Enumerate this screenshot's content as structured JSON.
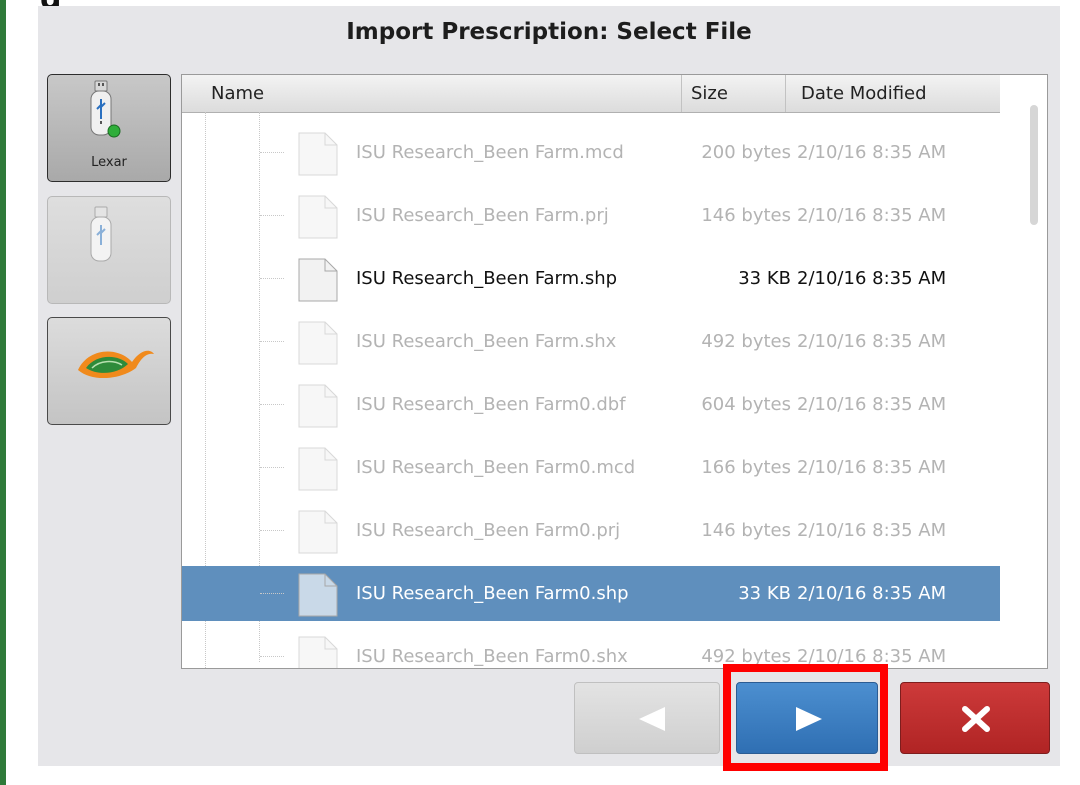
{
  "dialog": {
    "title": "Import Prescription: Select File"
  },
  "sources": [
    {
      "label": "Lexar",
      "icon": "usb-drive-icon"
    },
    {
      "label": "",
      "icon": "usb-drive-icon"
    },
    {
      "label": "",
      "icon": "leaf-logo-icon"
    }
  ],
  "filelist": {
    "columns": {
      "name": "Name",
      "size": "Size",
      "date": "Date Modified"
    },
    "rows": [
      {
        "name": "ISU Research_Been Farm.mcd",
        "size": "200 bytes",
        "date": "2/10/16 8:35 AM",
        "state": "disabled"
      },
      {
        "name": "ISU Research_Been Farm.prj",
        "size": "146 bytes",
        "date": "2/10/16 8:35 AM",
        "state": "disabled"
      },
      {
        "name": "ISU Research_Been Farm.shp",
        "size": "33 KB",
        "date": "2/10/16 8:35 AM",
        "state": "active"
      },
      {
        "name": "ISU Research_Been Farm.shx",
        "size": "492 bytes",
        "date": "2/10/16 8:35 AM",
        "state": "disabled"
      },
      {
        "name": "ISU Research_Been Farm0.dbf",
        "size": "604 bytes",
        "date": "2/10/16 8:35 AM",
        "state": "disabled"
      },
      {
        "name": "ISU Research_Been Farm0.mcd",
        "size": "166 bytes",
        "date": "2/10/16 8:35 AM",
        "state": "disabled"
      },
      {
        "name": "ISU Research_Been Farm0.prj",
        "size": "146 bytes",
        "date": "2/10/16 8:35 AM",
        "state": "disabled"
      },
      {
        "name": "ISU Research_Been Farm0.shp",
        "size": "33 KB",
        "date": "2/10/16 8:35 AM",
        "state": "selected"
      },
      {
        "name": "ISU Research_Been Farm0.shx",
        "size": "492 bytes",
        "date": "2/10/16 8:35 AM",
        "state": "disabled"
      }
    ]
  },
  "buttons": {
    "back": {
      "icon": "triangle-left-icon",
      "enabled": false
    },
    "next": {
      "icon": "triangle-right-icon",
      "enabled": true,
      "highlighted": true
    },
    "cancel": {
      "icon": "x-icon",
      "enabled": true
    }
  },
  "colors": {
    "selection": "#5f8fbd",
    "next_button": "#3a7dc2",
    "cancel_button": "#c03030",
    "highlight": "#ff0000",
    "side_bar": "#2f7a3a"
  }
}
